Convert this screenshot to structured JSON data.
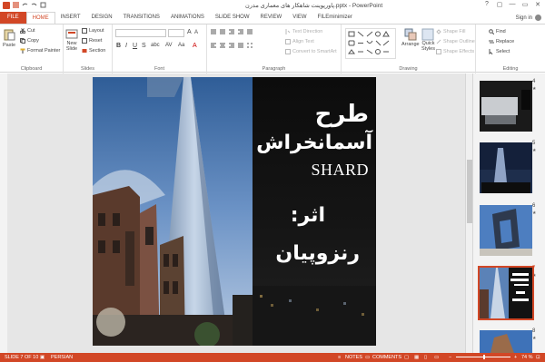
{
  "window": {
    "title": "پاورپوینت شاهکار های معماری مدرن.pptx - PowerPoint",
    "controls": [
      "?",
      "▢",
      "—",
      "▭",
      "✕"
    ]
  },
  "tabs": [
    {
      "label": "FILE"
    },
    {
      "label": "HOME"
    },
    {
      "label": "INSERT"
    },
    {
      "label": "DESIGN"
    },
    {
      "label": "TRANSITIONS"
    },
    {
      "label": "ANIMATIONS"
    },
    {
      "label": "SLIDE SHOW"
    },
    {
      "label": "REVIEW"
    },
    {
      "label": "VIEW"
    },
    {
      "label": "FILEminimizer"
    }
  ],
  "signin": "Sign in",
  "ribbon": {
    "clipboard": {
      "label": "Clipboard",
      "paste": "Paste",
      "cut": "Cut",
      "copy": "Copy",
      "format_painter": "Format Painter"
    },
    "slides": {
      "label": "Slides",
      "new_slide": "New",
      "new_slide2": "Slide",
      "layout": "Layout",
      "reset": "Reset",
      "section": "Section"
    },
    "font": {
      "label": "Font"
    },
    "paragraph": {
      "label": "Paragraph",
      "text_direction": "Text Direction",
      "align_text": "Align Text",
      "smartart": "Convert to SmartArt"
    },
    "drawing": {
      "label": "Drawing",
      "arrange": "Arrange",
      "quick_styles": "Quick",
      "quick_styles2": "Styles",
      "shape_fill": "Shape Fill",
      "shape_outline": "Shape Outline",
      "shape_effects": "Shape Effects"
    },
    "editing": {
      "label": "Editing",
      "find": "Find",
      "replace": "Replace",
      "select": "Select"
    }
  },
  "slide": {
    "line1": "طرح",
    "line2": "آسمانخراش",
    "line3": "SHARD",
    "line4": "اثر:",
    "line5": "رنزوپیان"
  },
  "thumbnails": [
    {
      "number": "4",
      "star": "★"
    },
    {
      "number": "5",
      "star": "★"
    },
    {
      "number": "6",
      "star": "★"
    },
    {
      "number": "7",
      "star": "★"
    },
    {
      "number": "8",
      "star": "★"
    }
  ],
  "status": {
    "slide_of": "SLIDE 7 OF 10",
    "language": "PERSIAN",
    "notes": "NOTES",
    "comments": "COMMENTS",
    "zoom": "74 %"
  },
  "colors": {
    "accent": "#d24726"
  }
}
